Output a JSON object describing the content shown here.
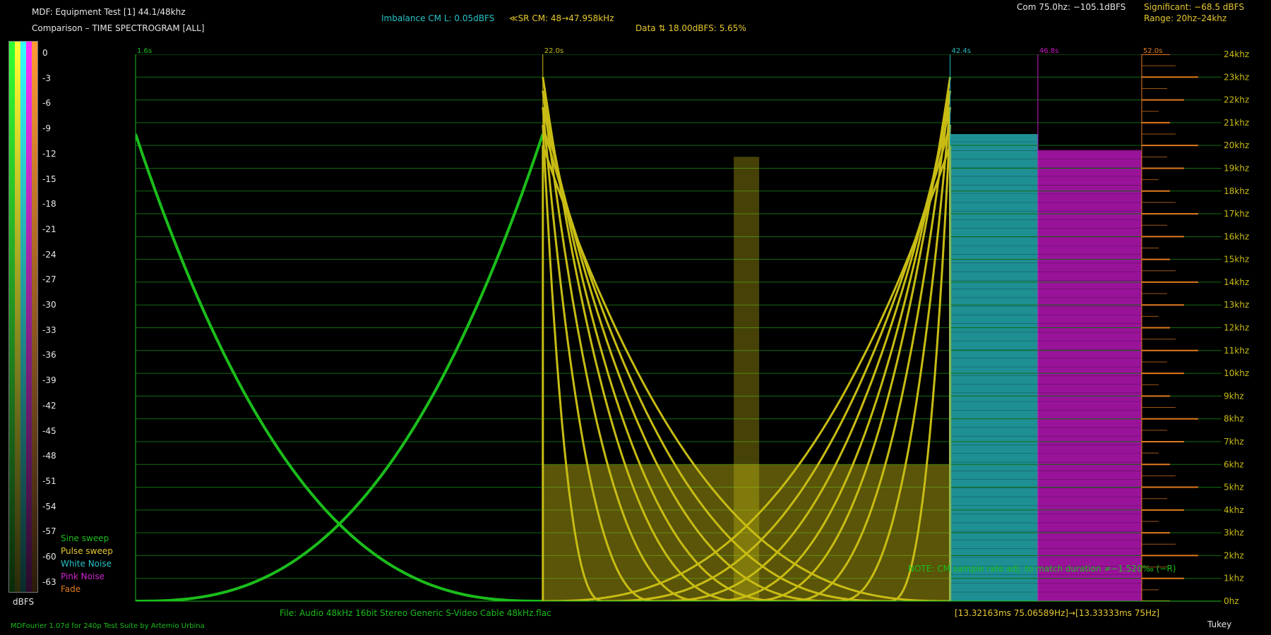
{
  "header": {
    "title": "MDF: Equipment Test [1] 44.1/48khz",
    "subtitle": "Comparison – TIME SPECTROGRAM [ALL]",
    "imbalance": "Imbalance CM L: 0.05dBFS",
    "sr": "≪SR CM: 48→47.958kHz",
    "data_line": "Data ⇅ 18.00dBFS: 5.65%",
    "com": "Com 75.0hz: −105.1dBFS",
    "significant": "Significant: −68.5 dBFS",
    "range": "Range: 20hz–24khz"
  },
  "footer": {
    "file": "File: Audio    48kHz 16bit Stereo Generic S-Video Cable 48kHz.flac",
    "timing": "[13.32163ms 75.06589Hz]→[13.33333ms 75Hz]",
    "credit": "MDFourier 1.07d for 240p Test Suite by Artemio Urbina",
    "window": "Tukey",
    "note": "NOTE: CM sample rate adj. to match duration ≠−1.520‰ (−R)"
  },
  "colors": {
    "green": "#1bbd1b",
    "yellow": "#c8bc14",
    "cyan": "#27b7bd",
    "magenta": "#c418c4",
    "orange": "#e07a1e",
    "grid": "#116b11"
  },
  "dbfs_scale": {
    "label": "dBFS",
    "ticks": [
      "0",
      "-3",
      "-6",
      "-9",
      "-12",
      "-15",
      "-18",
      "-21",
      "-24",
      "-27",
      "-30",
      "-33",
      "-36",
      "-39",
      "-42",
      "-45",
      "-48",
      "-51",
      "-54",
      "-57",
      "-60",
      "-63"
    ]
  },
  "chart_data": {
    "type": "heatmap",
    "title": "Comparison – TIME SPECTROGRAM [ALL]",
    "xlabel": "",
    "ylabel": "",
    "ylim": [
      0,
      24000
    ],
    "y_ticks": [
      "0hz",
      "1khz",
      "2khz",
      "3khz",
      "4khz",
      "5khz",
      "6khz",
      "7khz",
      "8khz",
      "9khz",
      "10khz",
      "11khz",
      "12khz",
      "13khz",
      "14khz",
      "15khz",
      "16khz",
      "17khz",
      "18khz",
      "19khz",
      "20khz",
      "21khz",
      "22khz",
      "23khz",
      "24khz"
    ],
    "xlim": [
      1.6,
      56.0
    ],
    "grid": true,
    "time_markers": [
      {
        "label": "1.6s",
        "time": 1.6,
        "color": "#1bbd1b"
      },
      {
        "label": "22.0s",
        "time": 22.0,
        "color": "#c8bc14"
      },
      {
        "label": "42.4s",
        "time": 42.4,
        "color": "#27b7bd"
      },
      {
        "label": "46.8s",
        "time": 46.8,
        "color": "#c418c4"
      },
      {
        "label": "52.0s",
        "time": 52.0,
        "color": "#e07a1e"
      }
    ],
    "segments": [
      {
        "name": "Sine sweep",
        "start": 1.6,
        "end": 22.0,
        "color": "#1bbd1b"
      },
      {
        "name": "Pulse sweep",
        "start": 22.0,
        "end": 42.4,
        "color": "#c8bc14"
      },
      {
        "name": "White Noise",
        "start": 42.4,
        "end": 46.8,
        "color": "#27b7bd"
      },
      {
        "name": "Pink Noise",
        "start": 46.8,
        "end": 52.0,
        "color": "#c418c4"
      },
      {
        "name": "Fade",
        "start": 52.0,
        "end": 56.0,
        "color": "#e07a1e"
      }
    ],
    "legend": [
      "Sine sweep",
      "Pulse sweep",
      "White Noise",
      "Pink Noise",
      "Fade"
    ],
    "legend_position": "bottom-left"
  }
}
